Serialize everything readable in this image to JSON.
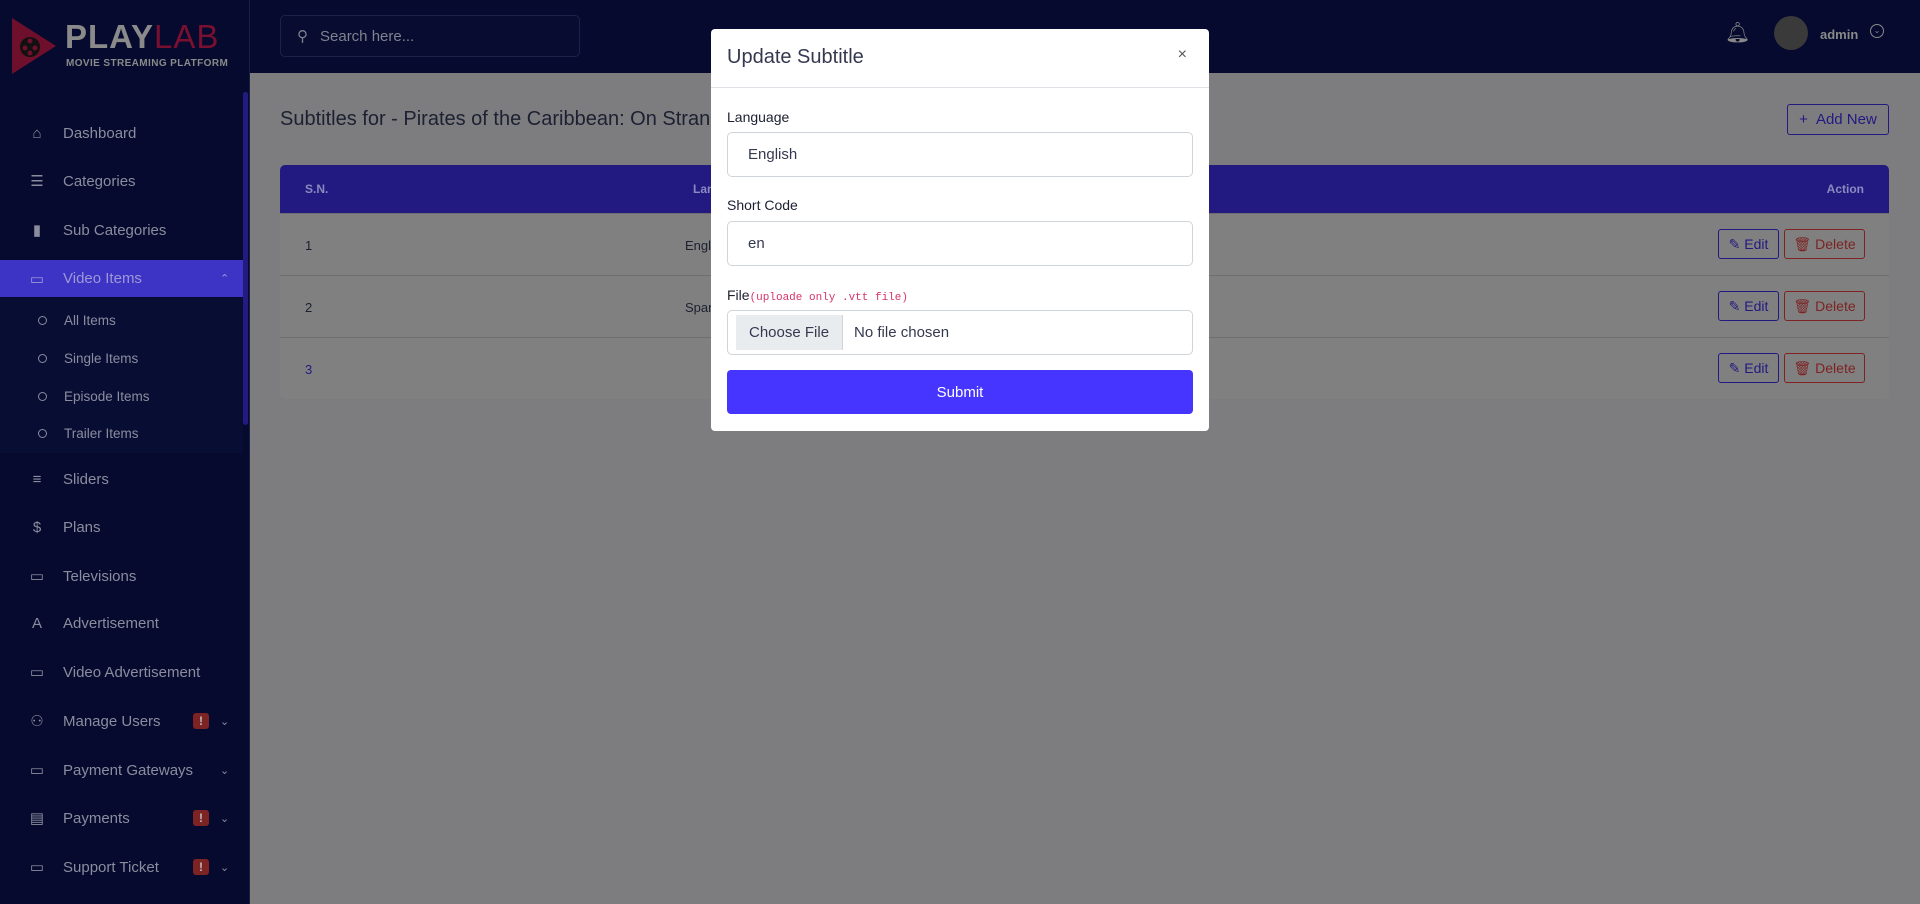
{
  "brand": {
    "name_bold": "PLAY",
    "name_light": "LAB",
    "tagline": "MOVIE STREAMING PLATFORM"
  },
  "colors": {
    "primary": "#4634ff",
    "danger": "#ea5455",
    "sidebar": "#071251"
  },
  "search": {
    "placeholder": "Search here..."
  },
  "header": {
    "username": "admin"
  },
  "sidebar": {
    "items": [
      {
        "label": "Dashboard",
        "icon": "home-icon"
      },
      {
        "label": "Categories",
        "icon": "menu-icon"
      },
      {
        "label": "Sub Categories",
        "icon": "bar-chart-icon"
      },
      {
        "label": "Video Items",
        "icon": "video-icon",
        "active": true,
        "expanded": true
      },
      {
        "label": "Sliders",
        "icon": "sliders-icon"
      },
      {
        "label": "Plans",
        "icon": "dollar-icon"
      },
      {
        "label": "Televisions",
        "icon": "tv-icon"
      },
      {
        "label": "Advertisement",
        "icon": "font-icon"
      },
      {
        "label": "Video Advertisement",
        "icon": "video-icon"
      },
      {
        "label": "Manage Users",
        "icon": "users-icon",
        "badge": "!"
      },
      {
        "label": "Payment Gateways",
        "icon": "credit-card-icon"
      },
      {
        "label": "Payments",
        "icon": "invoice-icon",
        "badge": "!"
      },
      {
        "label": "Support Ticket",
        "icon": "ticket-icon",
        "badge": "!"
      }
    ],
    "video_subitems": [
      "All Items",
      "Single Items",
      "Episode Items",
      "Trailer Items"
    ]
  },
  "main": {
    "title": "Subtitles for - Pirates of the Caribbean: On Stranger Tides",
    "add_new": "Add New",
    "table": {
      "headers": {
        "sn": "S.N.",
        "language": "Language",
        "action": "Action"
      },
      "rows": [
        {
          "sn": "1",
          "language": "English"
        },
        {
          "sn": "2",
          "language": "Spanish"
        },
        {
          "sn": "3",
          "language": ""
        }
      ],
      "edit": "Edit",
      "delete": "Delete"
    }
  },
  "modal": {
    "title": "Update Subtitle",
    "close": "×",
    "language_label": "Language",
    "language_value": "English",
    "short_code_label": "Short Code",
    "short_code_value": "en",
    "file_label": "File",
    "file_hint": "(uploade only .vtt file)",
    "choose_file": "Choose File",
    "no_file": "No file chosen",
    "submit": "Submit"
  }
}
